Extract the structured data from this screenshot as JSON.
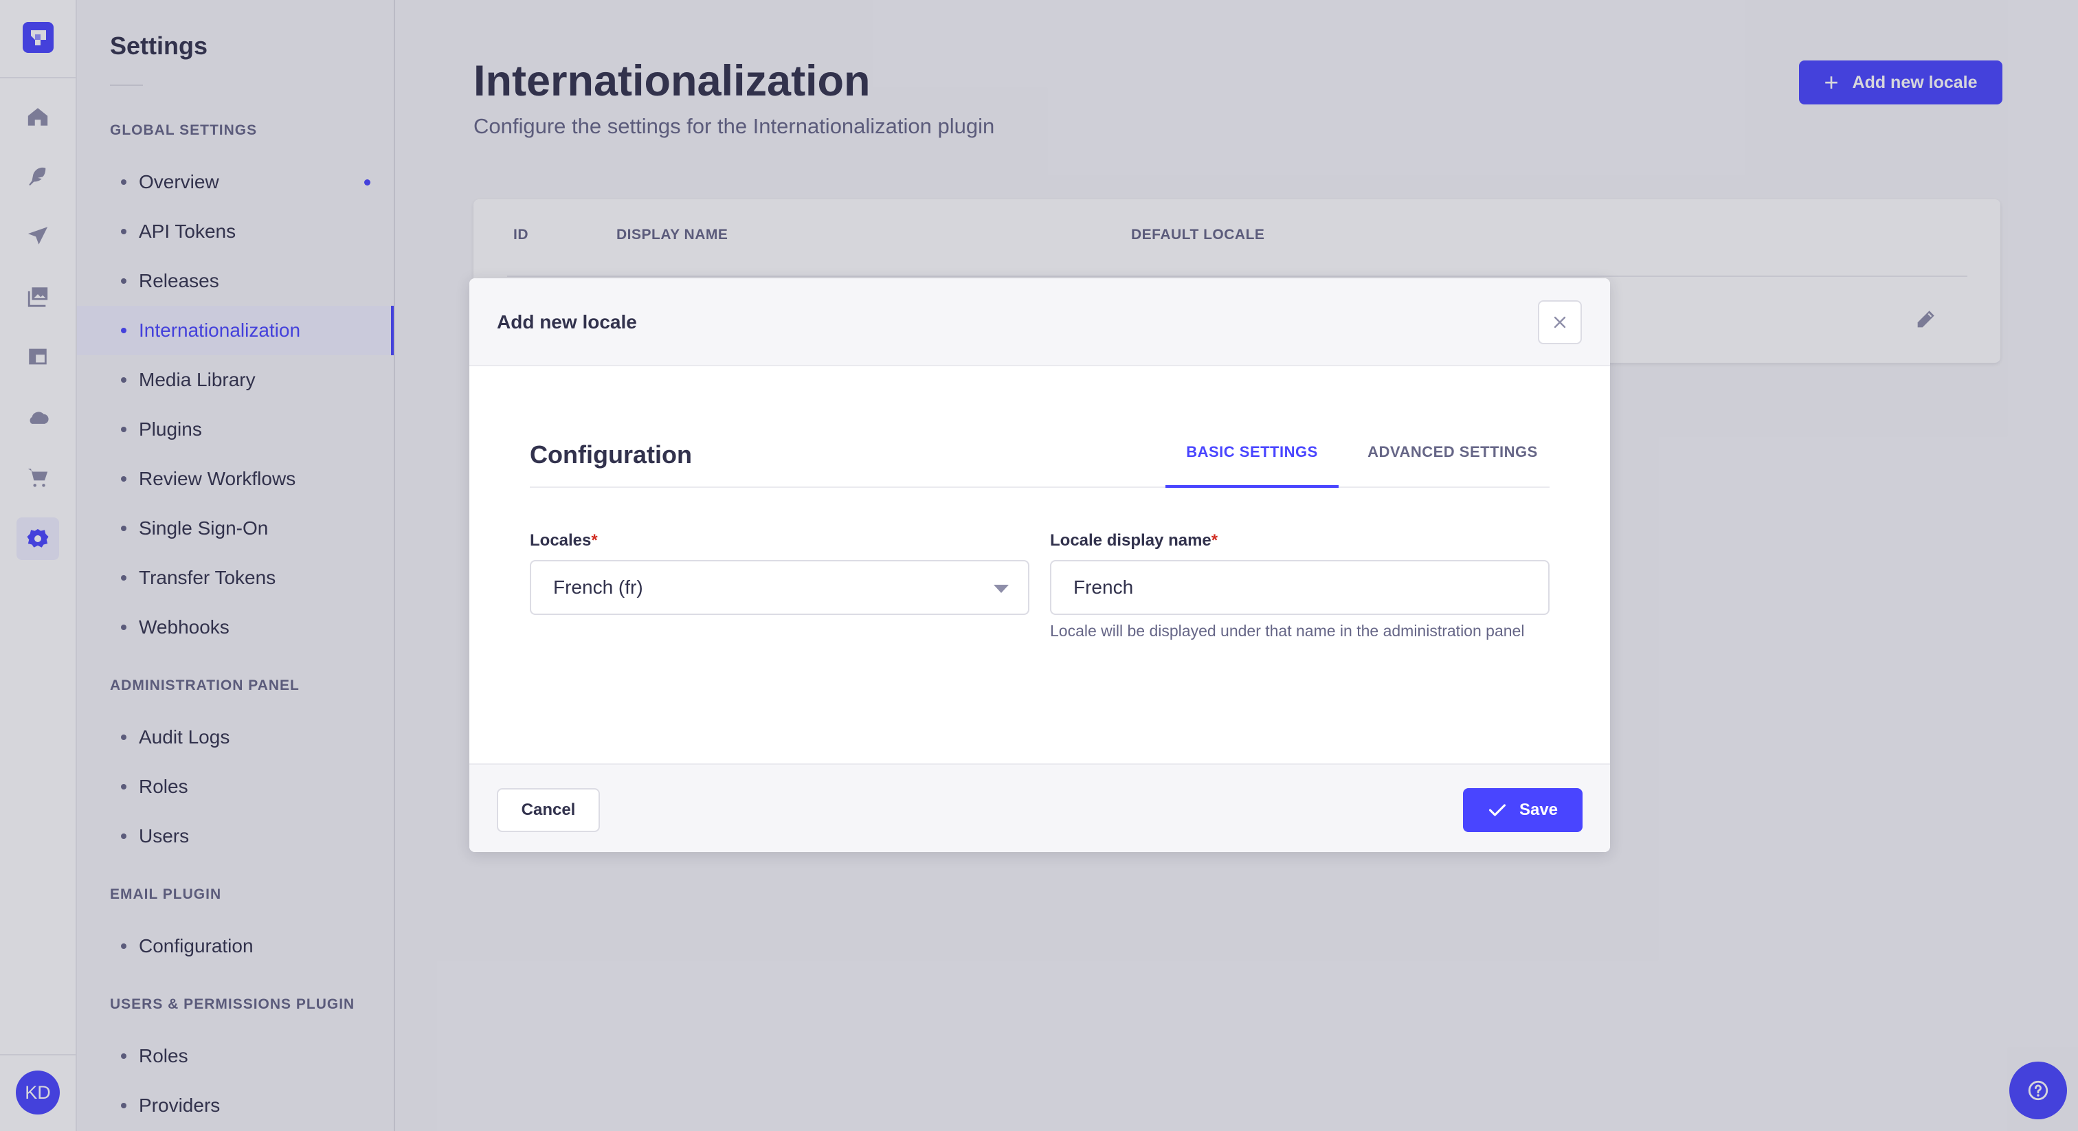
{
  "rail": {
    "logo": "strapi-logo-icon",
    "items": [
      {
        "icon": "home-icon",
        "label": "Home"
      },
      {
        "icon": "feather-icon",
        "label": "Content Manager"
      },
      {
        "icon": "paper-plane-icon",
        "label": "Releases"
      },
      {
        "icon": "images-icon",
        "label": "Media Library"
      },
      {
        "icon": "layout-icon",
        "label": "Content-Type Builder"
      },
      {
        "icon": "cloud-icon",
        "label": "Deploy"
      },
      {
        "icon": "cart-icon",
        "label": "Marketplace"
      },
      {
        "icon": "gear-icon",
        "label": "Settings",
        "active": true
      }
    ],
    "avatar_initials": "KD"
  },
  "subnav": {
    "title": "Settings",
    "sections": [
      {
        "label": "Global Settings",
        "items": [
          {
            "label": "Overview",
            "badge": true
          },
          {
            "label": "API Tokens"
          },
          {
            "label": "Releases"
          },
          {
            "label": "Internationalization",
            "active": true
          },
          {
            "label": "Media Library"
          },
          {
            "label": "Plugins"
          },
          {
            "label": "Review Workflows"
          },
          {
            "label": "Single Sign-On"
          },
          {
            "label": "Transfer Tokens"
          },
          {
            "label": "Webhooks"
          }
        ]
      },
      {
        "label": "Administration Panel",
        "items": [
          {
            "label": "Audit Logs"
          },
          {
            "label": "Roles"
          },
          {
            "label": "Users"
          }
        ]
      },
      {
        "label": "Email Plugin",
        "items": [
          {
            "label": "Configuration"
          }
        ]
      },
      {
        "label": "Users & Permissions Plugin",
        "items": [
          {
            "label": "Roles"
          },
          {
            "label": "Providers"
          }
        ]
      }
    ]
  },
  "header": {
    "title": "Internationalization",
    "subtitle": "Configure the settings for the Internationalization plugin",
    "add_button_label": "Add new locale"
  },
  "table": {
    "columns": [
      "ID",
      "DISPLAY NAME",
      "DEFAULT LOCALE"
    ],
    "row_action_icon": "pencil-icon"
  },
  "modal": {
    "title": "Add new locale",
    "section_title": "Configuration",
    "tabs": [
      {
        "label": "BASIC SETTINGS",
        "active": true
      },
      {
        "label": "ADVANCED SETTINGS",
        "active": false
      }
    ],
    "fields": {
      "locales": {
        "label": "Locales",
        "required_mark": "*",
        "value": "French (fr)"
      },
      "display_name": {
        "label": "Locale display name",
        "required_mark": "*",
        "value": "French",
        "hint": "Locale will be displayed under that name in the administration panel"
      }
    },
    "cancel_label": "Cancel",
    "save_label": "Save"
  },
  "help_button": "help-icon",
  "colors": {
    "primary": "#4945ff",
    "required": "#d02b20",
    "text": "#32324d",
    "muted": "#666687"
  }
}
